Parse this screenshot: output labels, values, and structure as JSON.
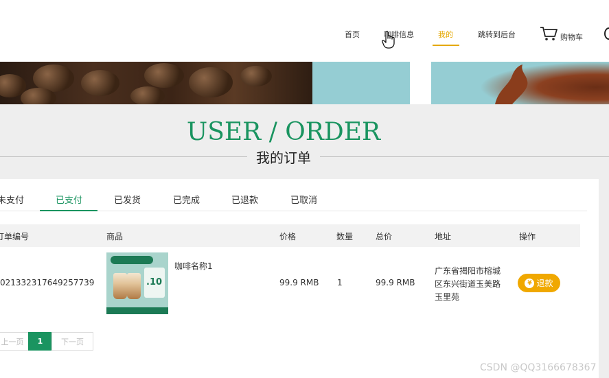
{
  "nav": {
    "items": [
      {
        "label": "首页"
      },
      {
        "label": "咖啡信息"
      },
      {
        "label": "我的"
      },
      {
        "label": "跳转到后台"
      }
    ],
    "cart_label": "购物车",
    "accent_color": "#e5a800"
  },
  "heading": {
    "title_en": "USER / ORDER",
    "title_cn": "我的订单",
    "color": "#1a9460"
  },
  "tabs": [
    {
      "label": "未支付"
    },
    {
      "label": "已支付"
    },
    {
      "label": "已发货"
    },
    {
      "label": "已完成"
    },
    {
      "label": "已退款"
    },
    {
      "label": "已取消"
    }
  ],
  "active_tab": "已支付",
  "table": {
    "headers": [
      "订单编号",
      "商品",
      "价格",
      "数量",
      "总价",
      "地址",
      "操作"
    ],
    "rows": [
      {
        "order_no": "021332317649257739",
        "product_name": "咖啡名称1",
        "price": "99.9 RMB",
        "quantity": "1",
        "total": "99.9 RMB",
        "address": "广东省揭阳市榕城区东兴街道玉美路玉里苑",
        "action": "退款"
      }
    ]
  },
  "thumbnail": {
    "badge_text": ".10"
  },
  "pagination": {
    "prev": "上一页",
    "current": "1",
    "next": "下一页"
  },
  "watermark": "CSDN @QQ3166678367"
}
